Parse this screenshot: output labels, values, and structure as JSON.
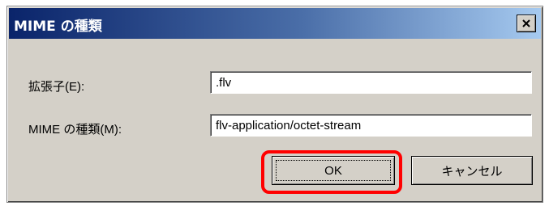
{
  "dialog": {
    "title": "MIME の種類",
    "close_icon": "close-icon"
  },
  "fields": {
    "extension_label": "拡張子(E):",
    "extension_value": ".flv",
    "mime_type_label": "MIME の種類(M):",
    "mime_type_value": "flv-application/octet-stream"
  },
  "buttons": {
    "ok_label": "OK",
    "cancel_label": "キャンセル"
  },
  "colors": {
    "highlight": "#ff0000",
    "title_bar_start": "#0a246a",
    "title_bar_end": "#a6caf0",
    "dialog_bg": "#d4d0c8"
  }
}
